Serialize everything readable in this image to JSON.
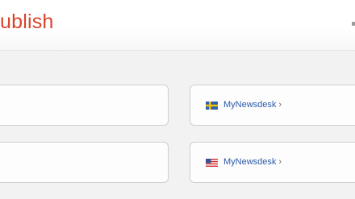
{
  "header": {
    "logo_text": "ublish"
  },
  "cards": [
    {
      "flag": "sweden-flag-icon",
      "link_label": "MyNewsdesk",
      "chevron": "›"
    },
    {
      "flag": "usa-flag-icon",
      "link_label": "MyNewsdesk",
      "chevron": "›"
    }
  ],
  "colors": {
    "logo": "#d8452c",
    "link": "#2b5aa8",
    "background": "#f2f2f2"
  }
}
